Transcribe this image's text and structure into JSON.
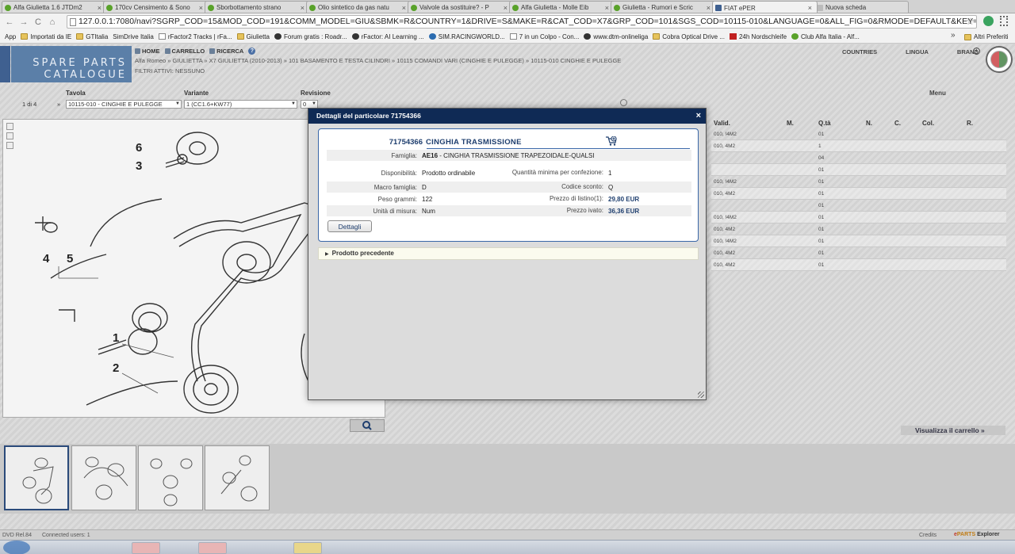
{
  "browser": {
    "tabs": [
      {
        "label": "Alfa Giulietta 1.6 JTDm2"
      },
      {
        "label": "170cv Censimento & Sono"
      },
      {
        "label": "Sborbottamento strano"
      },
      {
        "label": "Olio sintetico da gas natu"
      },
      {
        "label": "Valvole da sostituire? - P"
      },
      {
        "label": "Alfa Giulietta - Molle Eib"
      },
      {
        "label": "Giulietta - Rumori e Scric"
      },
      {
        "label": "FIAT ePER"
      },
      {
        "label": "Nuova scheda"
      }
    ],
    "close_glyph": "×",
    "nav": {
      "back": "←",
      "forward": "→",
      "reload": "C",
      "home": "⌂"
    },
    "url": "127.0.0.1:7080/navi?SGRP_COD=15&MOD_COD=191&COMM_MODEL=GIU&SBMK=R&COUNTRY=1&DRIVE=S&MAKE=R&CAT_COD=X7&GRP_COD=101&SGS_COD=10115-010&LANGUAGE=0&ALL_FIG=0&RMODE=DEFAULT&KEY=PAI",
    "star": "☆",
    "bookmarks": [
      {
        "label": "App",
        "icon": "grid"
      },
      {
        "label": "Importati da IE",
        "icon": "folder"
      },
      {
        "label": "GTItalia",
        "icon": "folder"
      },
      {
        "label": "SimDrive Italia",
        "icon": "grid"
      },
      {
        "label": "rFactor2 Tracks | rFa...",
        "icon": "page"
      },
      {
        "label": "Giulietta",
        "icon": "folder"
      },
      {
        "label": "Forum gratis : Roadr...",
        "icon": "dark"
      },
      {
        "label": "rFactor: AI Learning ...",
        "icon": "dark"
      },
      {
        "label": "SIM.RACINGWORLD...",
        "icon": "blue"
      },
      {
        "label": "7 in un Colpo - Con...",
        "icon": "page"
      },
      {
        "label": "www.dtm-onlineliga",
        "icon": "dark"
      },
      {
        "label": "Cobra Optical Drive ...",
        "icon": "folder"
      },
      {
        "label": "24h Nordschleife",
        "icon": "red"
      },
      {
        "label": "Club Alfa Italia - Alf...",
        "icon": "green"
      }
    ],
    "bookmarks_more": "»",
    "other_bookmarks": "Altri Preferiti"
  },
  "app": {
    "logo_line1": "SPARE PARTS",
    "logo_line2": "CATALOGUE",
    "menu": {
      "home": "HOME",
      "cart": "CARRELLO",
      "search": "RICERCA",
      "help": "?"
    },
    "breadcrumb": "Alfa Romeo » GIULIETTA » X7 GIULIETTA (2010-2013) » 101 BASAMENTO E TESTA CILINDRI » 10115 COMANDI VARI (CINGHIE E PULEGGE) » 10115-010 CINGHIE E PULEGGE",
    "filters": "FILTRI ATTIVI: NESSUNO",
    "header_right": {
      "countries": "COUNTRIES",
      "lingua": "LINGUA",
      "brand": "BRAND",
      "info": "i"
    },
    "labels": {
      "tavola": "Tavola",
      "variante": "Variante",
      "revisione": "Revisione",
      "menu": "Menu"
    },
    "pager": "1 di 4",
    "pager_arrow": "»",
    "tavola_value": "10115-010 - CINGHIE E PULEGGE",
    "variante_value": "1 (CC1.6+KW77)",
    "revisione_value": "0",
    "select_arrow": "▼",
    "figure_labels": [
      "6",
      "3",
      "4",
      "5",
      "1",
      "2"
    ],
    "grid": {
      "headers": {
        "valid": "Valid.",
        "m": "M.",
        "qta": "Q.tà",
        "n": "N.",
        "c": "C.",
        "col": "Col.",
        "r": "R."
      },
      "rows": [
        {
          "valid": "010, !4M2",
          "qta": "01"
        },
        {
          "valid": "010, 4M2",
          "qta": "1"
        },
        {
          "valid": "",
          "qta": "04"
        },
        {
          "valid": "",
          "qta": "01"
        },
        {
          "valid": "010, !4M2",
          "qta": "01"
        },
        {
          "valid": "010, 4M2",
          "qta": "01"
        },
        {
          "valid": "",
          "qta": "01"
        },
        {
          "valid": "010, !4M2",
          "qta": "01"
        },
        {
          "valid": "010, 4M2",
          "qta": "01"
        },
        {
          "valid": "010, !4M2",
          "qta": "01"
        },
        {
          "valid": "010, 4M2",
          "qta": "01"
        },
        {
          "valid": "010, 4M2",
          "qta": "01"
        }
      ]
    },
    "cart_link": "Visualizza il carrello »",
    "status": {
      "left": "DVD Rel.84",
      "users": "Connected users: 1",
      "credits": "Credits",
      "brand_left": "e",
      "brand_mid": "PARTS",
      "brand_right": "Explorer"
    }
  },
  "modal": {
    "title": "Dettagli del particolare 71754366",
    "close": "×",
    "part_code": "71754366",
    "part_name": "CINGHIA TRASMISSIONE",
    "famiglia_label": "Famiglia:",
    "famiglia_code": "AE16",
    "famiglia_desc": " - CINGHIA TRASMISSIONE TRAPEZOIDALE-QUALSI",
    "rows": [
      {
        "k1": "Disponibilità:",
        "v1": "Prodotto ordinabile",
        "k2": "Quantità minima per confezione:",
        "v2": "1"
      },
      {
        "k1": "Macro famiglia:",
        "v1": "D",
        "k2": "Codice sconto:",
        "v2": "Q"
      },
      {
        "k1": "Peso grammi:",
        "v1": "122",
        "k2": "Prezzo di listino(1):",
        "v2": "29,80 EUR"
      },
      {
        "k1": "Unità di misura:",
        "v1": "Num",
        "k2": "Prezzo ivato:",
        "v2": "36,36 EUR"
      }
    ],
    "dettagli_button": "Dettagli",
    "prev_product": "Prodotto precedente",
    "prev_arrow": "▶"
  },
  "colors": {
    "modal_title_bg": "#0f2a55",
    "accent": "#1e3e6e",
    "card_border": "#3a67a8",
    "logo_bg": "#5b7fa8"
  }
}
